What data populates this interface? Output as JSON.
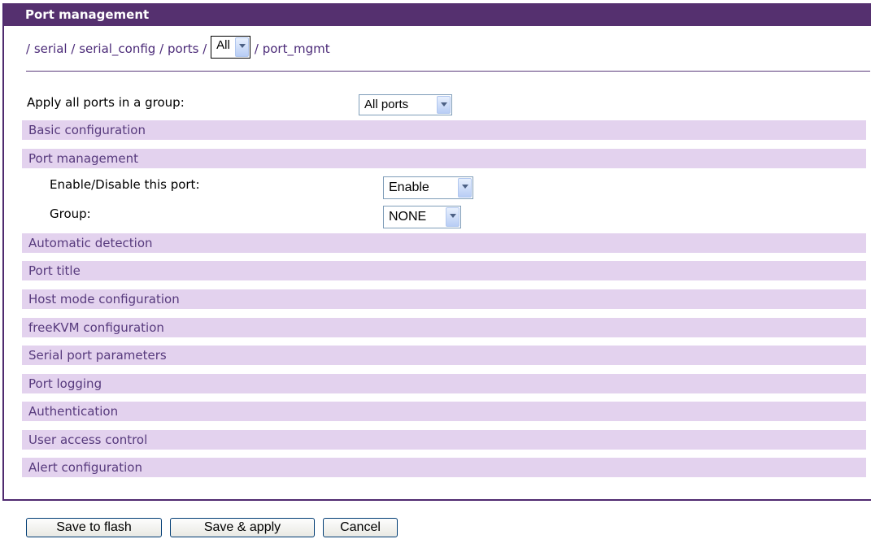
{
  "header": {
    "title": "Port management"
  },
  "breadcrumb": {
    "items": [
      "serial",
      "serial_config",
      "ports"
    ],
    "port_select": "All",
    "last": "port_mgmt",
    "separator": "/"
  },
  "apply_group": {
    "label": "Apply all ports in a group:",
    "value": "All ports"
  },
  "sections": {
    "basic": "Basic configuration",
    "port_mgmt": "Port management",
    "auto_detect": "Automatic detection",
    "port_title": "Port title",
    "host_mode": "Host mode configuration",
    "freekvm": "freeKVM configuration",
    "serial_params": "Serial port parameters",
    "port_logging": "Port logging",
    "authentication": "Authentication",
    "user_access": "User access control",
    "alert": "Alert configuration"
  },
  "port_settings": {
    "enable_label": "Enable/Disable this port:",
    "enable_value": "Enable",
    "group_label": "Group:",
    "group_value": "NONE"
  },
  "buttons": {
    "save_flash": "Save to flash",
    "save_apply": "Save & apply",
    "cancel": "Cancel"
  }
}
